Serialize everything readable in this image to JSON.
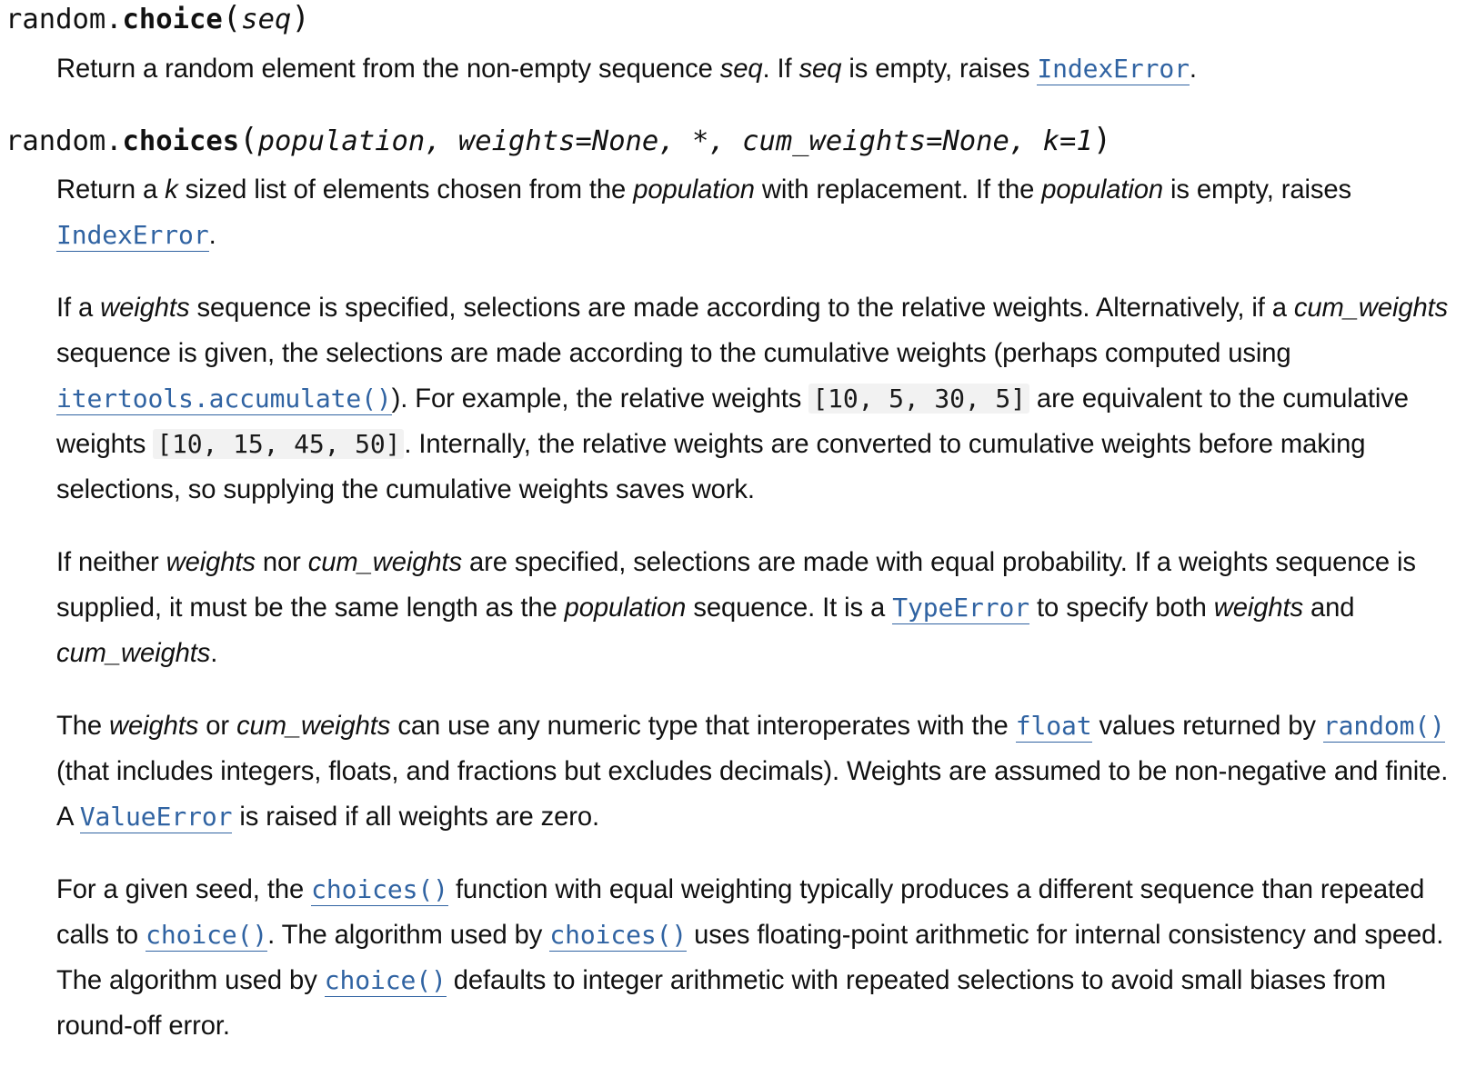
{
  "choice": {
    "signature": {
      "module": "random.",
      "name": "choice",
      "open": "(",
      "params": "seq",
      "close": ")"
    },
    "desc": {
      "t1": "Return a random element from the non-empty sequence ",
      "seq1": "seq",
      "t2": ". If ",
      "seq2": "seq",
      "t3": " is empty, raises ",
      "link_indexerror": "IndexError",
      "t4": "."
    }
  },
  "choices": {
    "signature": {
      "module": "random.",
      "name": "choices",
      "open": "(",
      "params": "population, weights=None, *, cum_weights=None, k=1",
      "close": ")"
    },
    "p1": {
      "t1": "Return a ",
      "k": "k",
      "t2": " sized list of elements chosen from the ",
      "population1": "population",
      "t3": " with replacement. If the ",
      "population2": "population",
      "t4": " is empty, raises ",
      "link_indexerror": "IndexError",
      "t5": "."
    },
    "p2": {
      "t1": "If a ",
      "weights": "weights",
      "t2": " sequence is specified, selections are made according to the relative weights. Alternatively, if a ",
      "cum_weights": "cum_weights",
      "t3": " sequence is given, the selections are made according to the cumulative weights (perhaps computed using ",
      "link_accumulate": "itertools.accumulate()",
      "t4": "). For example, the relative weights ",
      "code_relative": "[10, 5, 30, 5]",
      "t5": " are equivalent to the cumulative weights ",
      "code_cumulative": "[10, 15, 45, 50]",
      "t6": ". Internally, the relative weights are converted to cumulative weights before making selections, so supplying the cumulative weights saves work."
    },
    "p3": {
      "t1": "If neither ",
      "weights": "weights",
      "t2": " nor ",
      "cum_weights": "cum_weights",
      "t3": " are specified, selections are made with equal probability. If a weights sequence is supplied, it must be the same length as the ",
      "population": "population",
      "t4": " sequence. It is a ",
      "link_typeerror": "TypeError",
      "t5": " to specify both ",
      "weights2": "weights",
      "t6": " and ",
      "cum_weights2": "cum_weights",
      "t7": "."
    },
    "p4": {
      "t1": "The ",
      "weights": "weights",
      "t2": " or ",
      "cum_weights": "cum_weights",
      "t3": " can use any numeric type that interoperates with the ",
      "link_float": "float",
      "t4": " values returned by ",
      "link_random": "random()",
      "t5": " (that includes integers, floats, and fractions but excludes decimals). Weights are assumed to be non-negative and finite. A ",
      "link_valueerror": "ValueError",
      "t6": " is raised if all weights are zero."
    },
    "p5": {
      "t1": "For a given seed, the ",
      "link_choices1": "choices()",
      "t2": " function with equal weighting typically produces a different sequence than repeated calls to ",
      "link_choice1": "choice()",
      "t3": ". The algorithm used by ",
      "link_choices2": "choices()",
      "t4": " uses floating-point arithmetic for in­ternal consistency and speed. The algorithm used by ",
      "link_choice2": "choice()",
      "t5": " defaults to integer arithmetic with repeat­ed selections to avoid small biases from round-off error."
    }
  }
}
